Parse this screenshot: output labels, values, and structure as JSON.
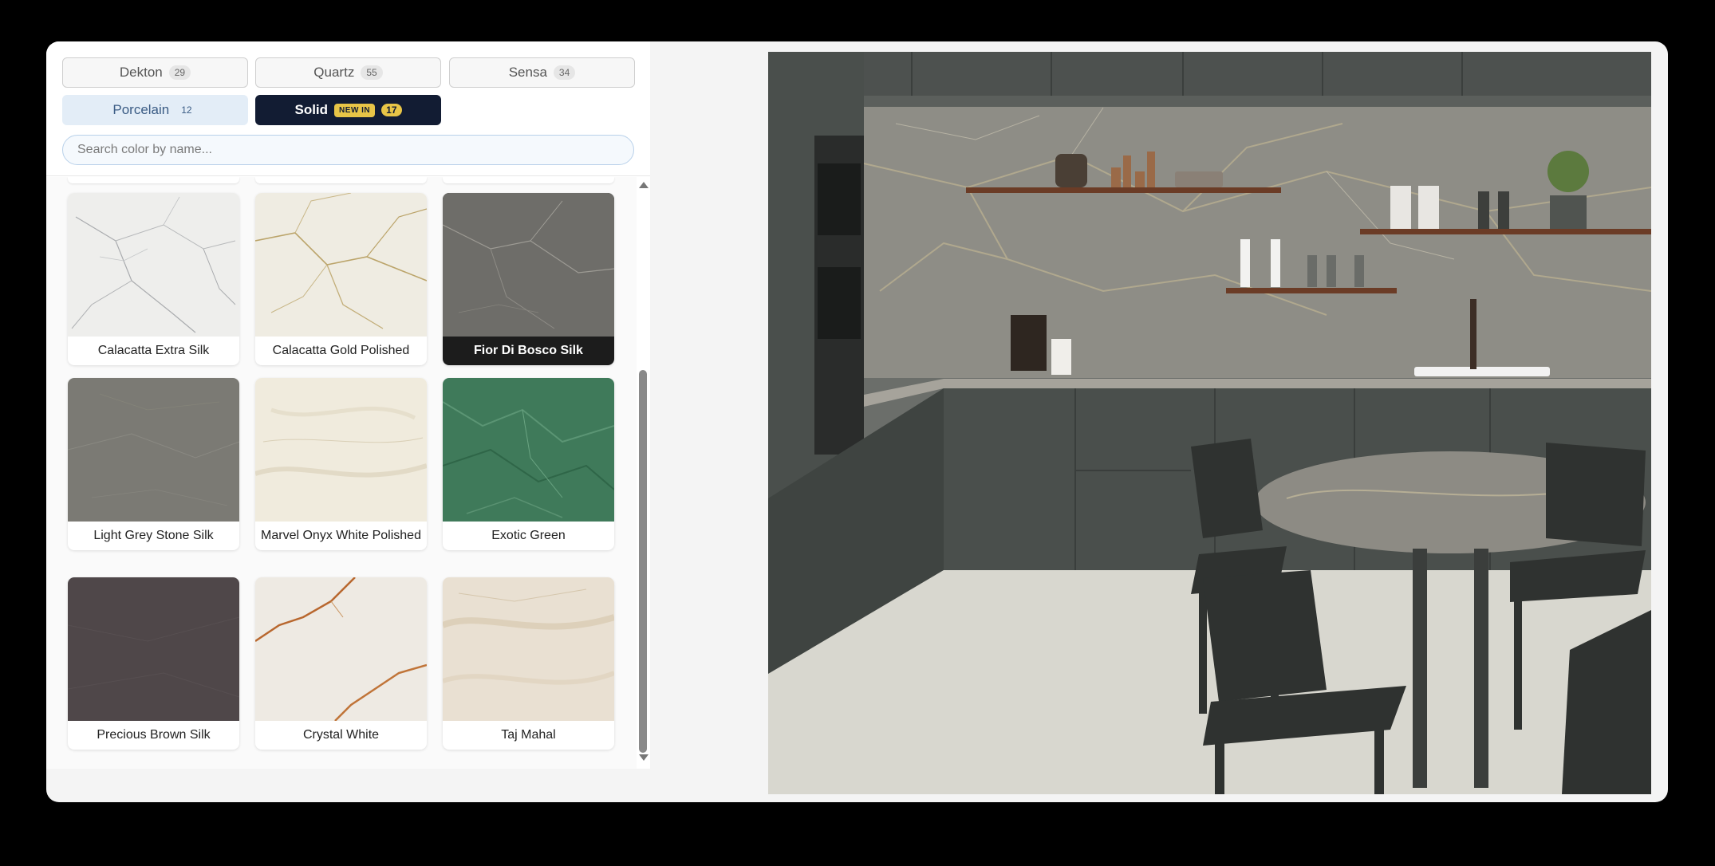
{
  "tabs": [
    {
      "label": "Dekton",
      "count": "29"
    },
    {
      "label": "Quartz",
      "count": "55"
    },
    {
      "label": "Sensa",
      "count": "34"
    },
    {
      "label": "Porcelain",
      "count": "12"
    },
    {
      "label": "Solid",
      "badge": "NEW IN",
      "count": "17"
    }
  ],
  "search": {
    "placeholder": "Search color by name..."
  },
  "colors": [
    {
      "name": "Calacatta Extra Silk"
    },
    {
      "name": "Calacatta Gold Polished"
    },
    {
      "name": "Fior Di Bosco Silk",
      "selected": true
    },
    {
      "name": "Light Grey Stone Silk"
    },
    {
      "name": "Marvel Onyx White Polished"
    },
    {
      "name": "Exotic Green"
    },
    {
      "name": "Precious Brown Silk"
    },
    {
      "name": "Crystal White"
    },
    {
      "name": "Taj Mahal"
    }
  ],
  "swatch_colors": [
    "#eeeeec",
    "#efece2",
    "#6e6d69",
    "#7b7a74",
    "#f0ebdd",
    "#3f7a5a",
    "#4f4749",
    "#eeeae3",
    "#e9e0d2"
  ],
  "preview": {
    "alt": "Kitchen scene with Fior Di Bosco Silk surfaces"
  }
}
